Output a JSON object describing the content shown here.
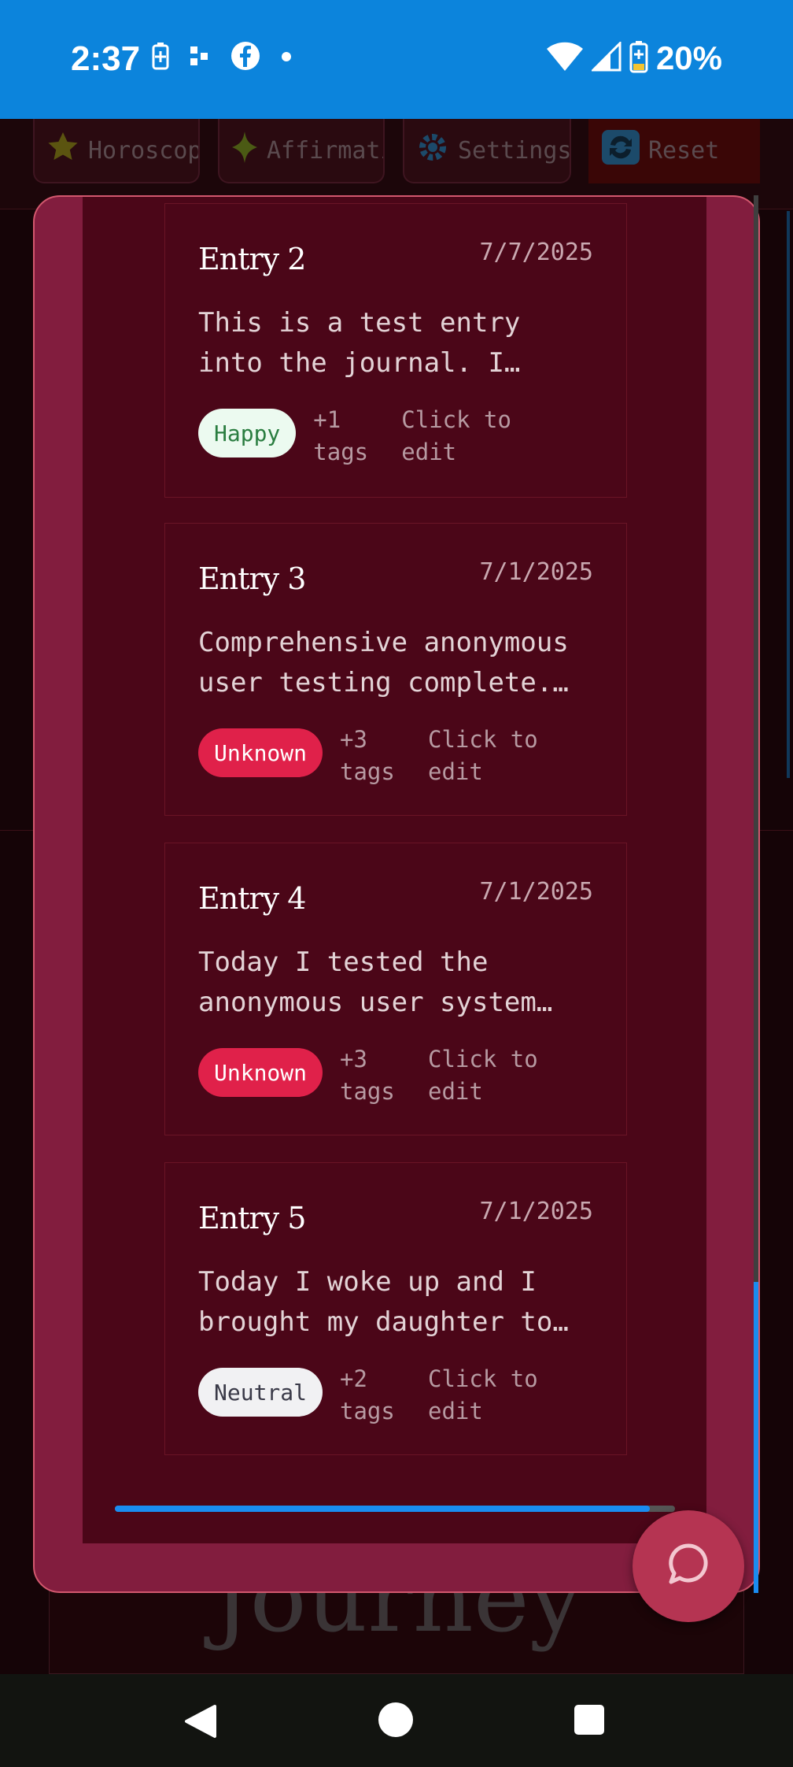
{
  "status_bar": {
    "time": "2:37",
    "battery": "20%",
    "icons": [
      "battery-saver-icon",
      "notification-dots-icon",
      "facebook-icon",
      "dot-icon",
      "wifi-icon",
      "signal-icon",
      "battery-icon"
    ]
  },
  "top_nav": {
    "items": [
      {
        "label": "Horoscope",
        "icon": "star-icon"
      },
      {
        "label": "Affirmations",
        "icon": "sparkle-icon"
      },
      {
        "label": "Settings",
        "icon": "gear-icon"
      },
      {
        "label": "Reset",
        "icon": "refresh-icon"
      }
    ]
  },
  "background": {
    "journey_heading": "Journey"
  },
  "entries": [
    {
      "title": "Entry 2",
      "date": "7/7/2025",
      "preview_line1": "This is a test entry",
      "preview_line2": "into the journal. I…",
      "mood": "Happy",
      "tags_count": "+1",
      "tags_word": "tags",
      "edit_line1": "Click to",
      "edit_line2": "edit"
    },
    {
      "title": "Entry 3",
      "date": "7/1/2025",
      "preview_line1": "Comprehensive anonymous",
      "preview_line2": "user testing complete.…",
      "mood": "Unknown",
      "tags_count": "+3",
      "tags_word": "tags",
      "edit_line1": "Click to",
      "edit_line2": "edit"
    },
    {
      "title": "Entry 4",
      "date": "7/1/2025",
      "preview_line1": "Today I tested the",
      "preview_line2": "anonymous user system…",
      "mood": "Unknown",
      "tags_count": "+3",
      "tags_word": "tags",
      "edit_line1": "Click to",
      "edit_line2": "edit"
    },
    {
      "title": "Entry 5",
      "date": "7/1/2025",
      "preview_line1": "Today I woke up and I",
      "preview_line2": "brought my daughter to…",
      "mood": "Neutral",
      "tags_count": "+2",
      "tags_word": "tags",
      "edit_line1": "Click to",
      "edit_line2": "edit"
    }
  ],
  "scroll": {
    "horizontal_position": 0.95,
    "vertical_position": 0.95
  },
  "fab": {
    "icon": "chat-bubble-icon"
  },
  "colors": {
    "status_bar": "#0c84dc",
    "modal": "#821d3e",
    "card": "#4b0618",
    "accent_scroll": "#1a8cf0",
    "happy_pill": "#ecfaf0",
    "unknown_pill": "#e0214a",
    "neutral_pill": "#f1f1f3",
    "fab": "#b53452"
  }
}
